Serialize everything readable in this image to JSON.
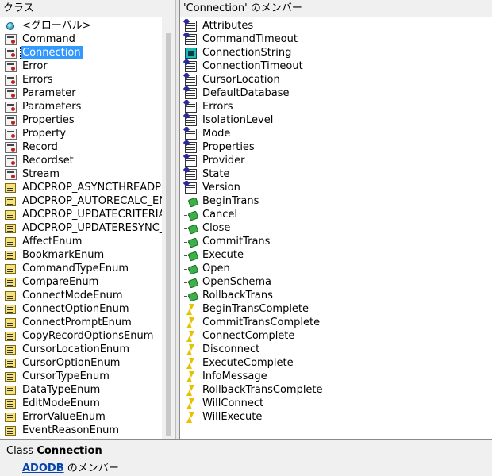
{
  "classes_pane": {
    "header": "クラス",
    "selected_index": 2,
    "items": [
      {
        "label": "<グローバル>",
        "icon": "global-icon"
      },
      {
        "label": "Command",
        "icon": "class-icon"
      },
      {
        "label": "Connection",
        "icon": "class-icon"
      },
      {
        "label": "Error",
        "icon": "class-icon"
      },
      {
        "label": "Errors",
        "icon": "class-icon"
      },
      {
        "label": "Parameter",
        "icon": "class-icon"
      },
      {
        "label": "Parameters",
        "icon": "class-icon"
      },
      {
        "label": "Properties",
        "icon": "class-icon"
      },
      {
        "label": "Property",
        "icon": "class-icon"
      },
      {
        "label": "Record",
        "icon": "class-icon"
      },
      {
        "label": "Recordset",
        "icon": "class-icon"
      },
      {
        "label": "Stream",
        "icon": "class-icon"
      },
      {
        "label": "ADCPROP_ASYNCTHREADPRIORITY_ENUM",
        "icon": "enum-icon"
      },
      {
        "label": "ADCPROP_AUTORECALC_ENUM",
        "icon": "enum-icon"
      },
      {
        "label": "ADCPROP_UPDATECRITERIA_ENUM",
        "icon": "enum-icon"
      },
      {
        "label": "ADCPROP_UPDATERESYNC_ENUM",
        "icon": "enum-icon"
      },
      {
        "label": "AffectEnum",
        "icon": "enum-icon"
      },
      {
        "label": "BookmarkEnum",
        "icon": "enum-icon"
      },
      {
        "label": "CommandTypeEnum",
        "icon": "enum-icon"
      },
      {
        "label": "CompareEnum",
        "icon": "enum-icon"
      },
      {
        "label": "ConnectModeEnum",
        "icon": "enum-icon"
      },
      {
        "label": "ConnectOptionEnum",
        "icon": "enum-icon"
      },
      {
        "label": "ConnectPromptEnum",
        "icon": "enum-icon"
      },
      {
        "label": "CopyRecordOptionsEnum",
        "icon": "enum-icon"
      },
      {
        "label": "CursorLocationEnum",
        "icon": "enum-icon"
      },
      {
        "label": "CursorOptionEnum",
        "icon": "enum-icon"
      },
      {
        "label": "CursorTypeEnum",
        "icon": "enum-icon"
      },
      {
        "label": "DataTypeEnum",
        "icon": "enum-icon"
      },
      {
        "label": "EditModeEnum",
        "icon": "enum-icon"
      },
      {
        "label": "ErrorValueEnum",
        "icon": "enum-icon"
      },
      {
        "label": "EventReasonEnum",
        "icon": "enum-icon"
      }
    ]
  },
  "members_pane": {
    "header": "'Connection' のメンバー",
    "items": [
      {
        "label": "Attributes",
        "icon": "property-icon"
      },
      {
        "label": "CommandTimeout",
        "icon": "property-icon"
      },
      {
        "label": "ConnectionString",
        "icon": "default-property-icon"
      },
      {
        "label": "ConnectionTimeout",
        "icon": "property-icon"
      },
      {
        "label": "CursorLocation",
        "icon": "property-icon"
      },
      {
        "label": "DefaultDatabase",
        "icon": "property-icon"
      },
      {
        "label": "Errors",
        "icon": "property-icon"
      },
      {
        "label": "IsolationLevel",
        "icon": "property-icon"
      },
      {
        "label": "Mode",
        "icon": "property-icon"
      },
      {
        "label": "Properties",
        "icon": "property-icon"
      },
      {
        "label": "Provider",
        "icon": "property-icon"
      },
      {
        "label": "State",
        "icon": "property-icon"
      },
      {
        "label": "Version",
        "icon": "property-icon"
      },
      {
        "label": "BeginTrans",
        "icon": "method-icon"
      },
      {
        "label": "Cancel",
        "icon": "method-icon"
      },
      {
        "label": "Close",
        "icon": "method-icon"
      },
      {
        "label": "CommitTrans",
        "icon": "method-icon"
      },
      {
        "label": "Execute",
        "icon": "method-icon"
      },
      {
        "label": "Open",
        "icon": "method-icon"
      },
      {
        "label": "OpenSchema",
        "icon": "method-icon"
      },
      {
        "label": "RollbackTrans",
        "icon": "method-icon"
      },
      {
        "label": "BeginTransComplete",
        "icon": "event-icon"
      },
      {
        "label": "CommitTransComplete",
        "icon": "event-icon"
      },
      {
        "label": "ConnectComplete",
        "icon": "event-icon"
      },
      {
        "label": "Disconnect",
        "icon": "event-icon"
      },
      {
        "label": "ExecuteComplete",
        "icon": "event-icon"
      },
      {
        "label": "InfoMessage",
        "icon": "event-icon"
      },
      {
        "label": "RollbackTransComplete",
        "icon": "event-icon"
      },
      {
        "label": "WillConnect",
        "icon": "event-icon"
      },
      {
        "label": "WillExecute",
        "icon": "event-icon"
      }
    ]
  },
  "details": {
    "class_prefix": "Class ",
    "class_name": "Connection",
    "library_link": "ADODB",
    "member_suffix": " のメンバー"
  },
  "colors": {
    "selection": "#3399ff",
    "link": "#0645ad"
  }
}
